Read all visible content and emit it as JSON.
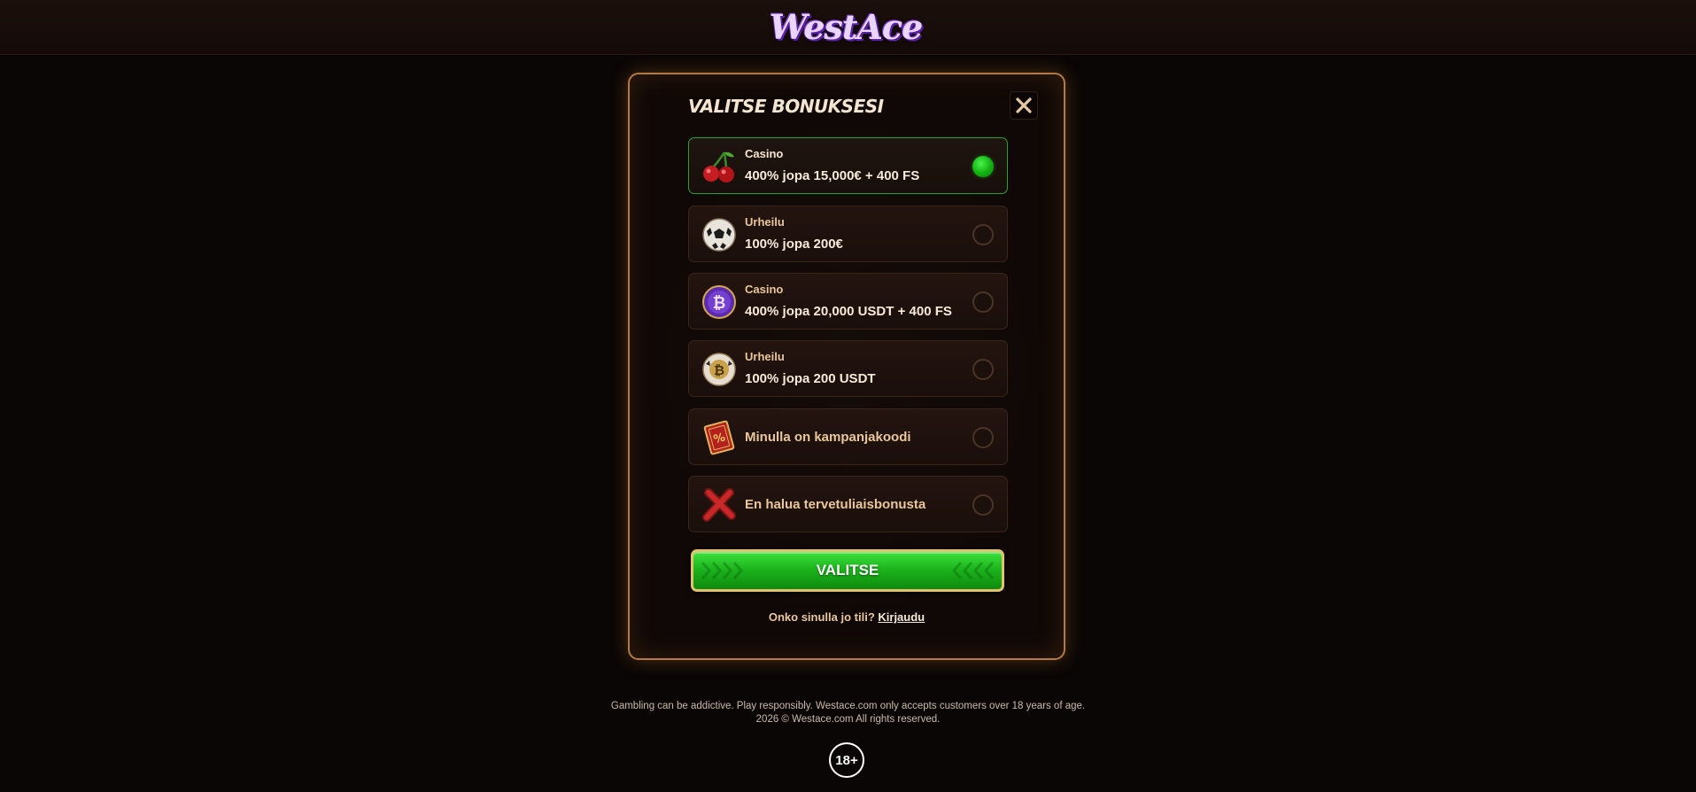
{
  "brand": {
    "logo_text": "WestAce"
  },
  "modal": {
    "title": "VALITSE BONUKSESI",
    "options": [
      {
        "category": "Casino",
        "title": "400% jopa 15,000€ + 400 FS",
        "icon": "cherry-icon",
        "selected": true
      },
      {
        "category": "Urheilu",
        "title": "100% jopa 200€",
        "icon": "soccer-ball-icon",
        "selected": false
      },
      {
        "category": "Casino",
        "title": "400% jopa 20,000 USDT + 400 FS",
        "icon": "bitcoin-coin-icon",
        "selected": false
      },
      {
        "category": "Urheilu",
        "title": "100% jopa 200 USDT",
        "icon": "bitcoin-ball-icon",
        "selected": false
      },
      {
        "label": "Minulla on kampanjakoodi",
        "icon": "promo-ticket-icon",
        "selected": false
      },
      {
        "label": "En halua tervetuliaisbonusta",
        "icon": "red-cross-icon",
        "selected": false
      }
    ],
    "submit_label": "VALITSE",
    "login_prompt": "Onko sinulla jo tili?",
    "login_link": "Kirjaudu"
  },
  "footer": {
    "line1": "Gambling can be addictive. Play responsibly. Westace.com only accepts customers over 18 years of age.",
    "line2": "2026 © Westace.com All rights reserved.",
    "age_badge": "18+"
  },
  "colors": {
    "background": "#0a0605",
    "accent_green": "#1db51d",
    "border_gold": "#b37a45",
    "text_gold": "#e9c79a"
  }
}
